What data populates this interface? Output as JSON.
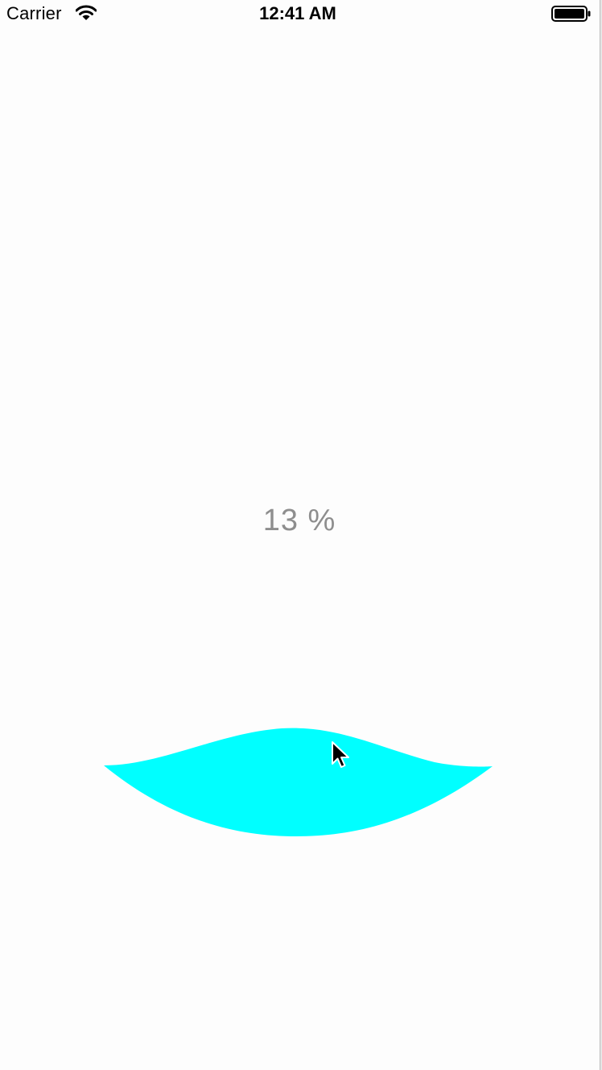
{
  "status_bar": {
    "carrier": "Carrier",
    "time": "12:41 AM",
    "wifi_icon": "wifi-icon",
    "battery_icon": "battery-icon"
  },
  "progress": {
    "label": "13 %",
    "value_percent": 13
  },
  "wave": {
    "color": "#00ffff"
  },
  "cursor_icon": "mouse-pointer-icon"
}
